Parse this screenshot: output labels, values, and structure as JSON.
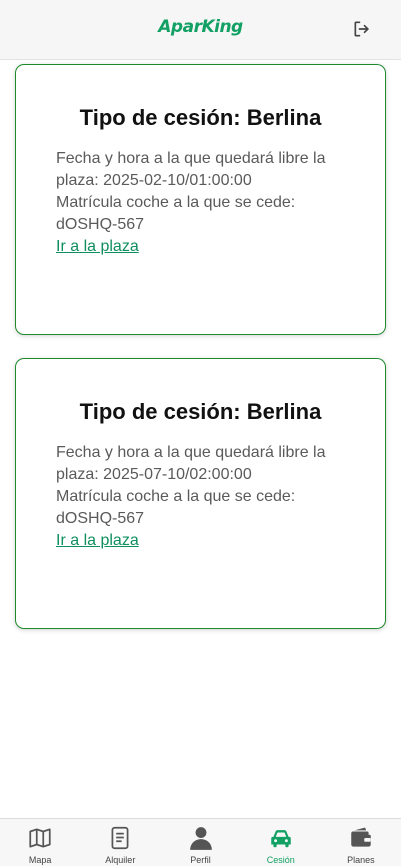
{
  "header": {
    "logo_text": "AparKing",
    "logout_icon": "logout-icon"
  },
  "cards": [
    {
      "title": "Tipo de cesión: Berlina",
      "date_line": "Fecha y hora a la que quedará libre la plaza: 2025-02-10/01:00:00",
      "plate_line": "Matrícula coche a la que se cede: dOSHQ-567",
      "link_text": "Ir a la plaza"
    },
    {
      "title": "Tipo de cesión: Berlina",
      "date_line": "Fecha y hora a la que quedará libre la plaza: 2025-07-10/02:00:00",
      "plate_line": "Matrícula coche a la que se cede: dOSHQ-567",
      "link_text": "Ir a la plaza"
    }
  ],
  "nav": {
    "items": [
      {
        "label": "Mapa",
        "icon": "map-icon"
      },
      {
        "label": "Alquiler",
        "icon": "document-icon"
      },
      {
        "label": "Perfil",
        "icon": "person-icon"
      },
      {
        "label": "Cesión",
        "icon": "car-icon",
        "active": true
      },
      {
        "label": "Planes",
        "icon": "wallet-icon"
      }
    ]
  },
  "colors": {
    "brand": "#12a064",
    "card_border": "#1e8a2c",
    "link": "#0f8e5f"
  }
}
